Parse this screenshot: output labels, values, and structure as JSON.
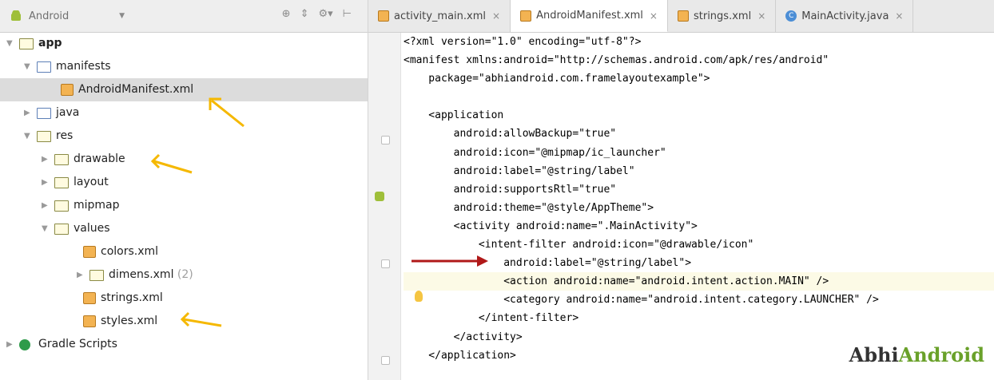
{
  "project": {
    "selector_label": "Android",
    "tree": [
      {
        "label": "app",
        "level": 0,
        "expanded": true,
        "icon": "module-folder"
      },
      {
        "label": "manifests",
        "level": 1,
        "expanded": true,
        "icon": "folder"
      },
      {
        "label": "AndroidManifest.xml",
        "level": 2,
        "icon": "xml-file",
        "selected": true
      },
      {
        "label": "java",
        "level": 1,
        "expanded": false,
        "icon": "folder"
      },
      {
        "label": "res",
        "level": 1,
        "expanded": true,
        "icon": "res-folder"
      },
      {
        "label": "drawable",
        "level": 2,
        "expanded": false,
        "icon": "folder"
      },
      {
        "label": "layout",
        "level": 2,
        "expanded": false,
        "icon": "folder"
      },
      {
        "label": "mipmap",
        "level": 2,
        "expanded": false,
        "icon": "folder"
      },
      {
        "label": "values",
        "level": 2,
        "expanded": true,
        "icon": "folder"
      },
      {
        "label": "colors.xml",
        "level": 3,
        "icon": "xml-file"
      },
      {
        "label": "dimens.xml",
        "count": "(2)",
        "level": 3,
        "expanded": false,
        "icon": "folder"
      },
      {
        "label": "strings.xml",
        "level": 3,
        "icon": "xml-file"
      },
      {
        "label": "styles.xml",
        "level": 3,
        "icon": "xml-file"
      },
      {
        "label": "Gradle Scripts",
        "level": 0,
        "expanded": false,
        "icon": "gradle"
      }
    ]
  },
  "editor": {
    "tabs": [
      {
        "label": "activity_main.xml",
        "active": false,
        "icon": "xml"
      },
      {
        "label": "AndroidManifest.xml",
        "active": true,
        "icon": "xml"
      },
      {
        "label": "strings.xml",
        "active": false,
        "icon": "xml"
      },
      {
        "label": "MainActivity.java",
        "active": false,
        "icon": "java"
      }
    ],
    "close_glyph": "×",
    "lines": [
      "<?xml version=\"1.0\" encoding=\"utf-8\"?>",
      "<manifest xmlns:android=\"http://schemas.android.com/apk/res/android\"",
      "    package=\"abhiandroid.com.framelayoutexample\">",
      "",
      "    <application",
      "        android:allowBackup=\"true\"",
      "        android:icon=\"@mipmap/ic_launcher\"",
      "        android:label=\"@string/label\"",
      "        android:supportsRtl=\"true\"",
      "        android:theme=\"@style/AppTheme\">",
      "        <activity android:name=\".MainActivity\">",
      "            <intent-filter android:icon=\"@drawable/icon\"",
      "                android:label=\"@string/label\">",
      "                <action android:name=\"android.intent.action.MAIN\" />",
      "                <category android:name=\"android.intent.category.LAUNCHER\" />",
      "            </intent-filter>",
      "        </activity>",
      "    </application>"
    ]
  },
  "watermark": {
    "part1": "Abhi",
    "part2": "Android"
  },
  "colors": {
    "tag": "#000080",
    "attr": "#0000ff",
    "value": "#008000",
    "arrow_yellow": "#f5b800",
    "arrow_red": "#b01818"
  }
}
